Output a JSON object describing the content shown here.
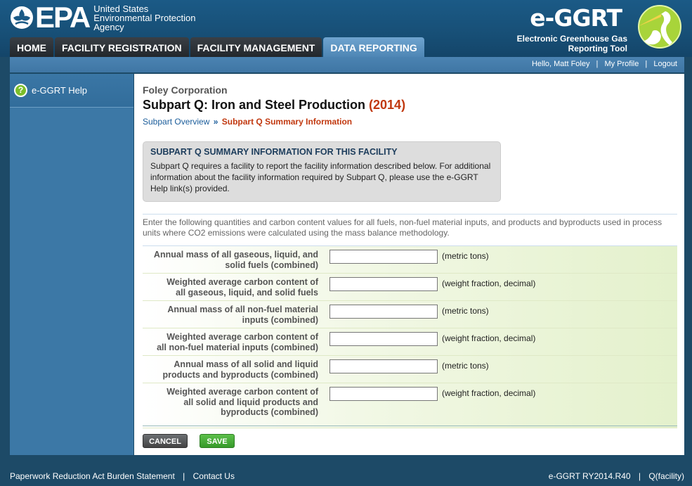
{
  "header": {
    "epa_letters": "EPA",
    "epa_agency_line1": "United States",
    "epa_agency_line2": "Environmental Protection",
    "epa_agency_line3": "Agency",
    "app_logo": "e-GGRT",
    "app_subtitle_line1": "Electronic Greenhouse Gas",
    "app_subtitle_line2": "Reporting Tool"
  },
  "tabs": [
    {
      "label": "HOME"
    },
    {
      "label": "FACILITY REGISTRATION"
    },
    {
      "label": "FACILITY MANAGEMENT"
    },
    {
      "label": "DATA REPORTING",
      "active": true
    }
  ],
  "user_nav": {
    "greeting": "Hello, Matt Foley",
    "my_profile": "My Profile",
    "logout": "Logout"
  },
  "sidebar": {
    "help_label": "e-GGRT Help",
    "help_icon": "question-circle-icon"
  },
  "main": {
    "company": "Foley Corporation",
    "title": "Subpart Q: Iron and Steel Production",
    "year": "(2014)",
    "breadcrumb_link": "Subpart Overview",
    "breadcrumb_sep": "»",
    "breadcrumb_current": "Subpart Q Summary Information",
    "info_title": "SUBPART Q SUMMARY INFORMATION FOR THIS FACILITY",
    "info_text": "Subpart Q requires a facility to report the facility information described below. For additional information about the facility information required by Subpart Q, please use the e-GGRT Help link(s) provided.",
    "instructions": "Enter the following quantities and carbon content values for all fuels, non-fuel material inputs, and products and byproducts used in process units where CO2 emissions were calculated using the mass balance methodology.",
    "fields": [
      {
        "label_1": "Annual mass of all gaseous, liquid, and",
        "label_2": "solid fuels (combined)",
        "label_3": "",
        "value": "",
        "unit": "(metric tons)"
      },
      {
        "label_1": "Weighted average carbon content of",
        "label_2": "all gaseous, liquid, and solid fuels",
        "label_3": "",
        "value": "",
        "unit": "(weight fraction, decimal)"
      },
      {
        "label_1": "Annual mass of all non-fuel material",
        "label_2": "inputs (combined)",
        "label_3": "",
        "value": "",
        "unit": "(metric tons)"
      },
      {
        "label_1": "Weighted average carbon content of",
        "label_2": "all non-fuel material inputs (combined)",
        "label_3": "",
        "value": "",
        "unit": "(weight fraction, decimal)"
      },
      {
        "label_1": "Annual mass of all solid and liquid",
        "label_2": "products and byproducts (combined)",
        "label_3": "",
        "value": "",
        "unit": "(metric tons)"
      },
      {
        "label_1": "Weighted average carbon content of",
        "label_2": "all solid and liquid products and",
        "label_3": "byproducts (combined)",
        "value": "",
        "unit": "(weight fraction, decimal)"
      }
    ],
    "cancel_label": "CANCEL",
    "save_label": "SAVE"
  },
  "footer": {
    "paperwork": "Paperwork Reduction Act Burden Statement",
    "contact": "Contact Us",
    "version": "e-GGRT RY2014.R40",
    "page_id": "Q(facility)"
  },
  "colors": {
    "header_bg": "#1b5a86",
    "active_tab": "#6fa4cf",
    "year_accent": "#c1380f",
    "save_green": "#369a2a",
    "help_green": "#7cbe2a"
  }
}
